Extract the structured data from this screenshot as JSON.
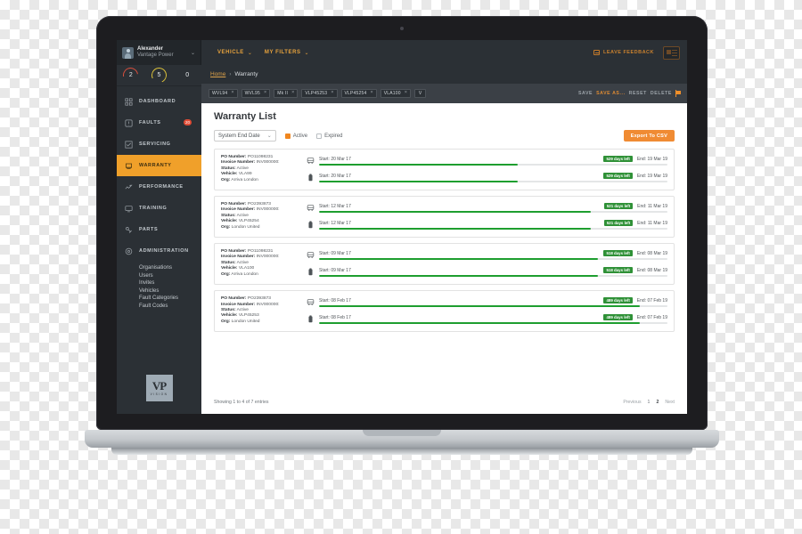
{
  "topbar": {
    "user_name": "Alexander",
    "user_org": "Vantage Power",
    "user_caret": "⌄",
    "menus": [
      {
        "label": "VEHICLE",
        "caret": "⌄"
      },
      {
        "label": "MY FILTERS",
        "caret": "⌄"
      }
    ],
    "feedback_label": "LEAVE FEEDBACK",
    "feedback_icon": "comment-icon",
    "id_card_icon": "id-card-icon",
    "avatar_icon": "avatar"
  },
  "counters": [
    {
      "value": "2",
      "color": "#d94f3d"
    },
    {
      "value": "5",
      "color": "#ddc33a"
    },
    {
      "value": "0",
      "color": "#6d747a"
    }
  ],
  "sidebar": {
    "items": [
      {
        "label": "DASHBOARD",
        "icon": "dashboard-icon",
        "active": false,
        "badge": ""
      },
      {
        "label": "FAULTS",
        "icon": "fault-icon",
        "active": false,
        "badge": "20"
      },
      {
        "label": "SERVICING",
        "icon": "servicing-icon",
        "active": false,
        "badge": ""
      },
      {
        "label": "WARRANTY",
        "icon": "warranty-icon",
        "active": true,
        "badge": ""
      },
      {
        "label": "PERFORMANCE",
        "icon": "performance-icon",
        "active": false,
        "badge": ""
      },
      {
        "label": "TRAINING",
        "icon": "training-icon",
        "active": false,
        "badge": ""
      },
      {
        "label": "PARTS",
        "icon": "parts-icon",
        "active": false,
        "badge": ""
      },
      {
        "label": "ADMINISTRATION",
        "icon": "administration-icon",
        "active": false,
        "badge": ""
      }
    ],
    "subitems": [
      "Organisations",
      "Users",
      "Invites",
      "Vehicles",
      "Fault Categories",
      "Fault Codes"
    ],
    "logo_mark": "VP",
    "logo_sub": "VISION"
  },
  "breadcrumb": {
    "home": "Home",
    "separator": "›",
    "current": "Warranty"
  },
  "tagbar": {
    "tags": [
      "WVL94",
      "WVL95",
      "Mk II",
      "VLP45253",
      "VLP45254",
      "VLA100"
    ],
    "tag_close": "×",
    "more": "V",
    "actions": [
      {
        "label": "SAVE",
        "style": "grey"
      },
      {
        "label": "SAVE AS...",
        "style": "orange"
      },
      {
        "label": "RESET",
        "style": "grey"
      },
      {
        "label": "DELETE",
        "style": "grey"
      }
    ],
    "flag_icon": "flag-icon"
  },
  "page": {
    "title": "Warranty List",
    "sort_select": {
      "value": "System End Date",
      "caret": "⌄"
    },
    "filters": [
      {
        "label": "Active",
        "checked": true
      },
      {
        "label": "Expired",
        "checked": false
      }
    ],
    "export_label": "Export To CSV",
    "accent_color": "#f08b33",
    "progress_color": "#1e9e2f",
    "pill_color": "#2f9137"
  },
  "rows": [
    {
      "po_label": "PO Number:",
      "po_value": "PO11098231",
      "inv_label": "Invoice Number:",
      "inv_value": "INV000000:",
      "status_label": "Status:",
      "status_value": "Active",
      "vehicle_label": "Vehicle:",
      "vehicle_value": "VLA99",
      "org_label": "Org:",
      "org_value": "Arriva London",
      "bars": [
        {
          "icon": "bus-icon",
          "start": "Start: 20 Mar 17",
          "pill": "529 days left",
          "end": "End: 19 Mar 19",
          "percent": 57
        },
        {
          "icon": "battery-icon",
          "start": "Start: 20 Mar 17",
          "pill": "529 days left",
          "end": "End: 19 Mar 19",
          "percent": 57
        }
      ]
    },
    {
      "po_label": "PO Number:",
      "po_value": "PO2393873",
      "inv_label": "Invoice Number:",
      "inv_value": "INV000000:",
      "status_label": "Status:",
      "status_value": "Active",
      "vehicle_label": "Vehicle:",
      "vehicle_value": "VLP45254",
      "org_label": "Org:",
      "org_value": "London United",
      "bars": [
        {
          "icon": "bus-icon",
          "start": "Start: 12 Mar 17",
          "pill": "521 days left",
          "end": "End: 11 Mar 19",
          "percent": 78
        },
        {
          "icon": "battery-icon",
          "start": "Start: 12 Mar 17",
          "pill": "521 days left",
          "end": "End: 11 Mar 19",
          "percent": 78
        }
      ]
    },
    {
      "po_label": "PO Number:",
      "po_value": "PO11098231",
      "inv_label": "Invoice Number:",
      "inv_value": "INV000000:",
      "status_label": "Status:",
      "status_value": "Active",
      "vehicle_label": "Vehicle:",
      "vehicle_value": "VLA100",
      "org_label": "Org:",
      "org_value": "Arriva London",
      "bars": [
        {
          "icon": "bus-icon",
          "start": "Start: 09 Mar 17",
          "pill": "518 days left",
          "end": "End: 08 Mar 19",
          "percent": 80
        },
        {
          "icon": "battery-icon",
          "start": "Start: 09 Mar 17",
          "pill": "518 days left",
          "end": "End: 08 Mar 19",
          "percent": 80
        }
      ]
    },
    {
      "po_label": "PO Number:",
      "po_value": "PO2393873",
      "inv_label": "Invoice Number:",
      "inv_value": "INV000000:",
      "status_label": "Status:",
      "status_value": "Active",
      "vehicle_label": "Vehicle:",
      "vehicle_value": "VLP45253",
      "org_label": "Org:",
      "org_value": "London United",
      "bars": [
        {
          "icon": "bus-icon",
          "start": "Start: 08 Feb 17",
          "pill": "489 days left",
          "end": "End: 07 Feb 19",
          "percent": 92
        },
        {
          "icon": "battery-icon",
          "start": "Start: 08 Feb 17",
          "pill": "489 days left",
          "end": "End: 07 Feb 19",
          "percent": 92
        }
      ]
    }
  ],
  "footer": {
    "info": "Showing 1 to 4 of 7 entries",
    "previous": "Previous",
    "pages": [
      "1",
      "2"
    ],
    "current_page": "1",
    "next": "Next"
  }
}
